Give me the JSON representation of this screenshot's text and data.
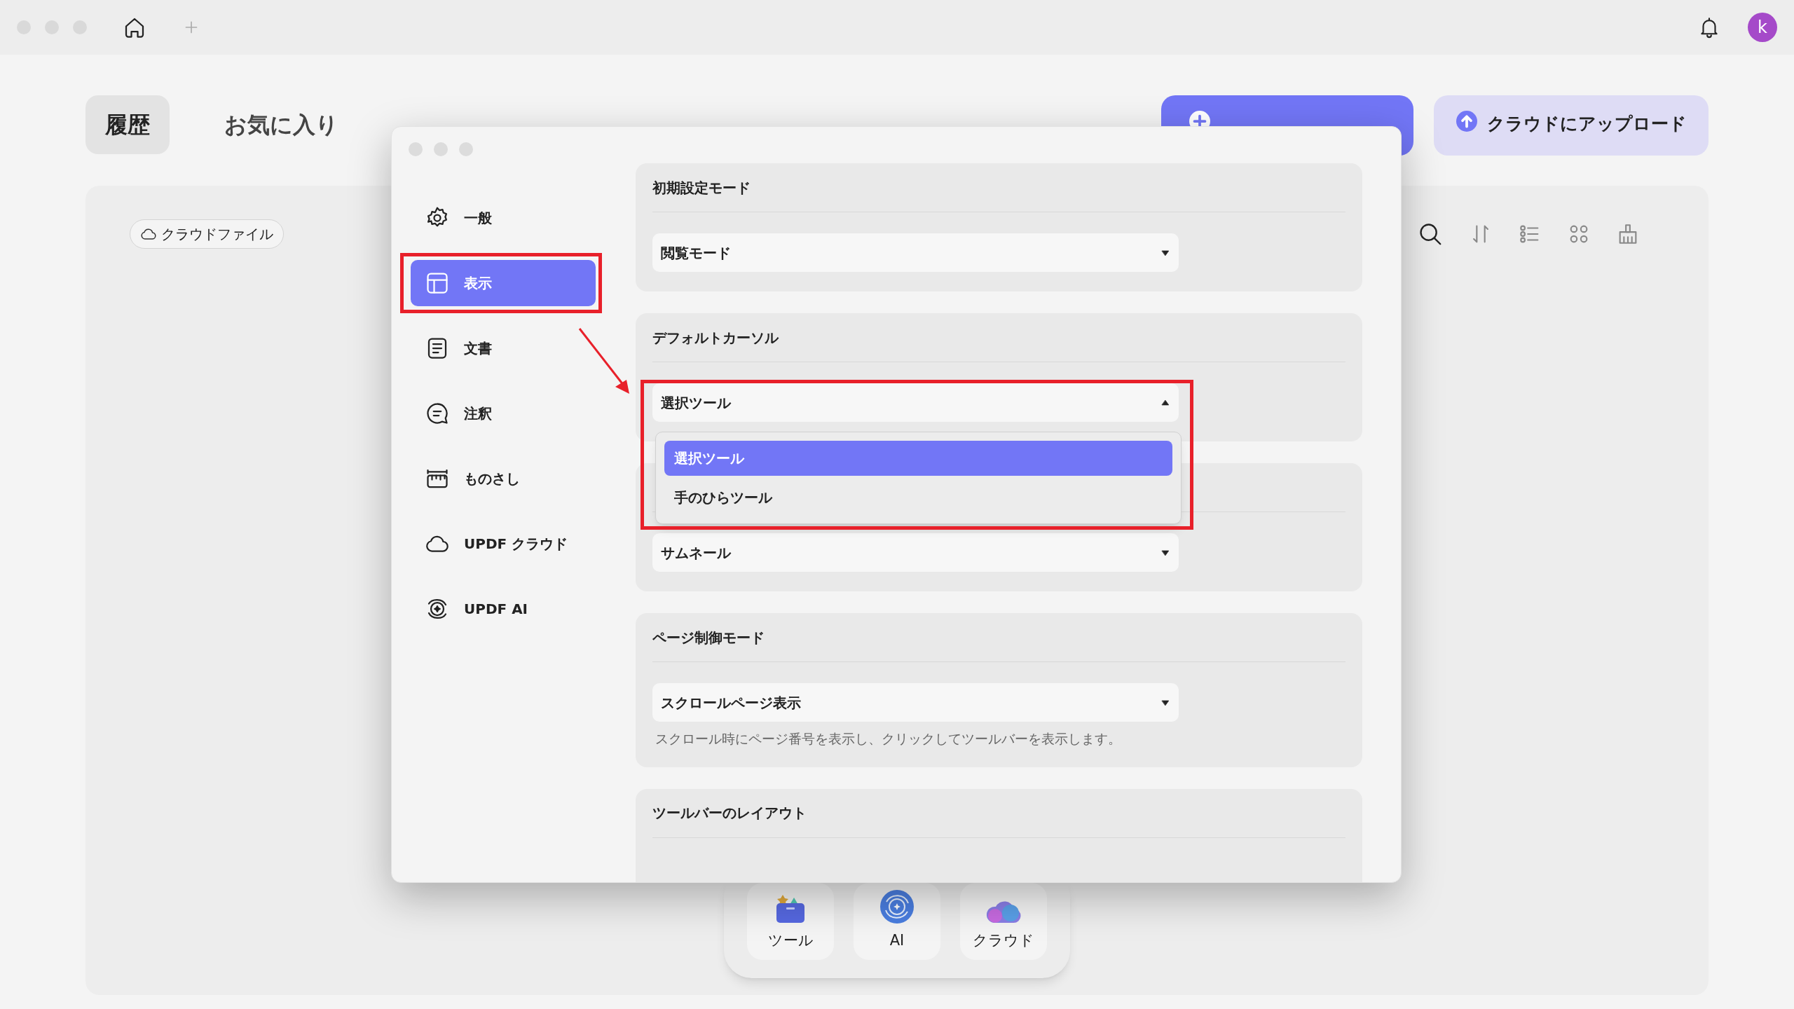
{
  "top_bar": {
    "avatar_letter": "k"
  },
  "home_tabs": [
    {
      "label": "履歴",
      "selected": true
    },
    {
      "label": "お気に入り",
      "selected": false
    }
  ],
  "actions": [
    {
      "kind": "primary"
    },
    {
      "label": "クラウドにアップロード",
      "kind": "secondary"
    }
  ],
  "cloud_chip": "クラウドファイル",
  "dock": [
    {
      "label": "ツール",
      "kind": "tools"
    },
    {
      "label": "AI",
      "kind": "ai"
    },
    {
      "label": "クラウド",
      "kind": "cloud"
    }
  ],
  "settings": {
    "sidebar": [
      {
        "label": "一般",
        "kind": "gear",
        "selected": false
      },
      {
        "label": "表示",
        "kind": "layout",
        "selected": true
      },
      {
        "label": "文書",
        "kind": "document",
        "selected": false
      },
      {
        "label": "注釈",
        "kind": "comment",
        "selected": false
      },
      {
        "label": "ものさし",
        "kind": "ruler",
        "selected": false
      },
      {
        "label": "UPDF クラウド",
        "kind": "cloud",
        "selected": false
      },
      {
        "label": "UPDF AI",
        "kind": "ai",
        "selected": false
      }
    ],
    "sections": [
      {
        "title": "初期設定モード",
        "value": "閲覧モード",
        "expanded": false
      },
      {
        "title": "デフォルトカーソル",
        "value": "選択ツール",
        "expanded": true,
        "options": [
          {
            "label": "選択ツール",
            "selected": true
          },
          {
            "label": "手のひらツール",
            "selected": false
          }
        ]
      },
      {
        "value": "サムネール",
        "expanded": false
      },
      {
        "title": "ページ制御モード",
        "value": "スクロールページ表示",
        "expanded": false,
        "note": "スクロール時にページ番号を表示し、クリックしてツールバーを表示します。"
      },
      {
        "title": "ツールバーのレイアウト"
      }
    ]
  }
}
